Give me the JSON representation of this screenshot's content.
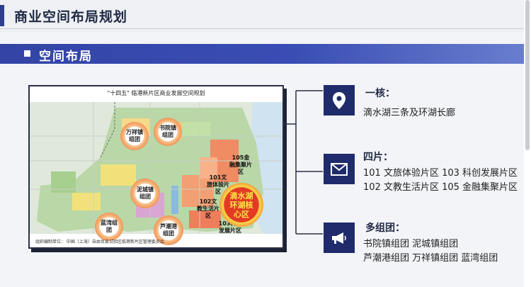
{
  "header": {
    "title": "商业空间布局规划"
  },
  "section": {
    "label": "空间布局"
  },
  "map": {
    "title": "\"十四五\"  临港新片区商业发展空间规划",
    "footer": "组织编制单位：   中国（上海）自由贸易试验区临港新片区管理委员会",
    "groups": {
      "wanxiang": "万祥镇组团",
      "shuyuan": "书院镇组团",
      "nicheng": "泥城镇组团",
      "lanwan": "蓝湾组团",
      "luchaogang": "芦潮港组团"
    },
    "zones": {
      "z105": "105金融集聚片区",
      "z101": "101文旅体验片区",
      "z102": "102文教生活片区",
      "z103": "103科创发展片区"
    },
    "core": "滴水湖环湖核心区"
  },
  "info": [
    {
      "icon": "location-pin-icon",
      "heading": "一核：",
      "lines": [
        "滴水湖三条及环湖长廊"
      ]
    },
    {
      "icon": "envelope-icon",
      "heading": "四片：",
      "lines": [
        "101 文旅体验片区  103 科创发展片区",
        "102 文教生活片区  105 金融集聚片区"
      ]
    },
    {
      "icon": "megaphone-icon",
      "heading": "多组团：",
      "lines": [
        "书院镇组团      泥城镇组团",
        "芦潮港组团      万祥镇组团      蓝湾组团"
      ]
    }
  ],
  "colors": {
    "accent": "#2e3f8f",
    "band": "#3344a6",
    "icon_box": "#1f2b6b",
    "core": "#e23a23"
  }
}
